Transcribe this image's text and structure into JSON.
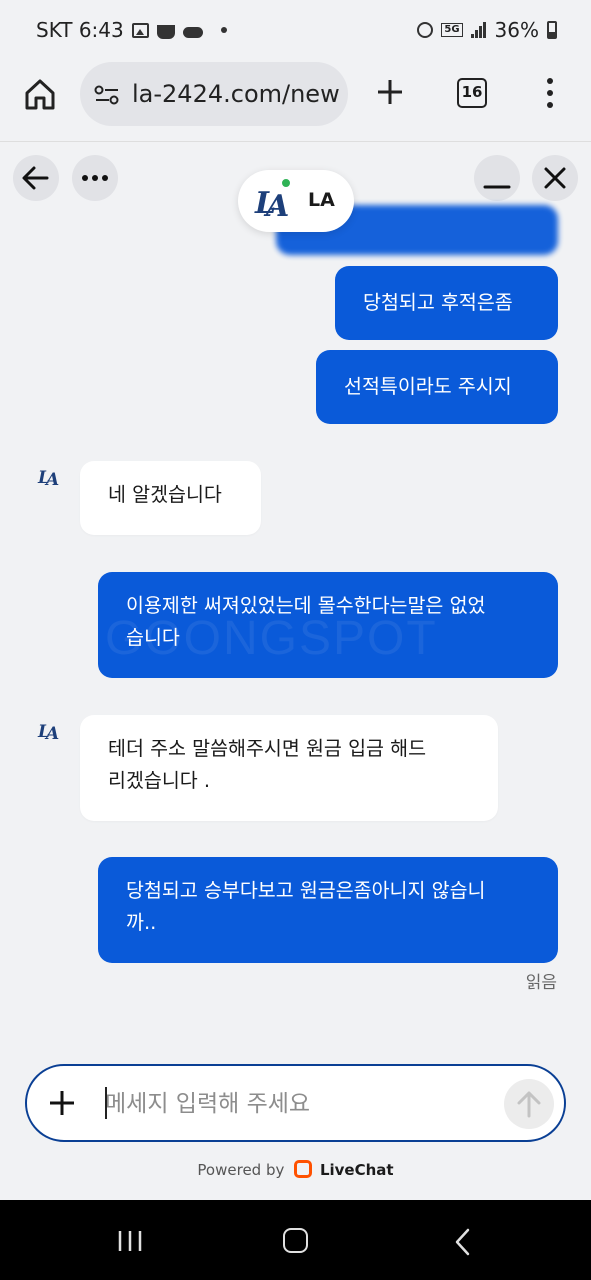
{
  "status_bar": {
    "carrier_time": "SKT 6:43",
    "network_badge": "5G",
    "battery": "36%"
  },
  "browser": {
    "url": "la-2424.com/new",
    "tab_count": "16",
    "icons": [
      "home-icon",
      "site-settings-icon",
      "plus-icon",
      "tabs-icon",
      "menu-icon"
    ]
  },
  "chat": {
    "agent_name": "LA",
    "agent_online": true,
    "messages": [
      {
        "from": "visitor",
        "text": ""
      },
      {
        "from": "visitor",
        "text": "당첨되고 후적은좀"
      },
      {
        "from": "visitor",
        "text": "선적특이라도 주시지"
      },
      {
        "from": "agent",
        "text": "네 알겠습니다"
      },
      {
        "from": "visitor",
        "lines": [
          "이용제한 써져있었는데 몰수한다는말은 없었",
          "습니다"
        ]
      },
      {
        "from": "agent",
        "lines": [
          "테더 주소 말씀해주시면 원금 입금 해드",
          "리겠습니다 ."
        ]
      },
      {
        "from": "visitor",
        "lines": [
          "당첨되고 승부다보고 원금은좀아니지 않습니",
          "까.."
        ]
      }
    ],
    "read_receipt": "읽음",
    "watermark": "GOONGSPOT",
    "composer_placeholder": "메세지 입력해 주세요",
    "powered_by": "Powered by",
    "powered_brand": "LiveChat"
  },
  "colors": {
    "visitor_bubble": "#0a5ad9",
    "agent_bubble": "#ffffff",
    "background": "#f1f2f4",
    "composer_border": "#0a3f94",
    "online_dot": "#2fb356",
    "livechat_brand": "#ff5100"
  }
}
